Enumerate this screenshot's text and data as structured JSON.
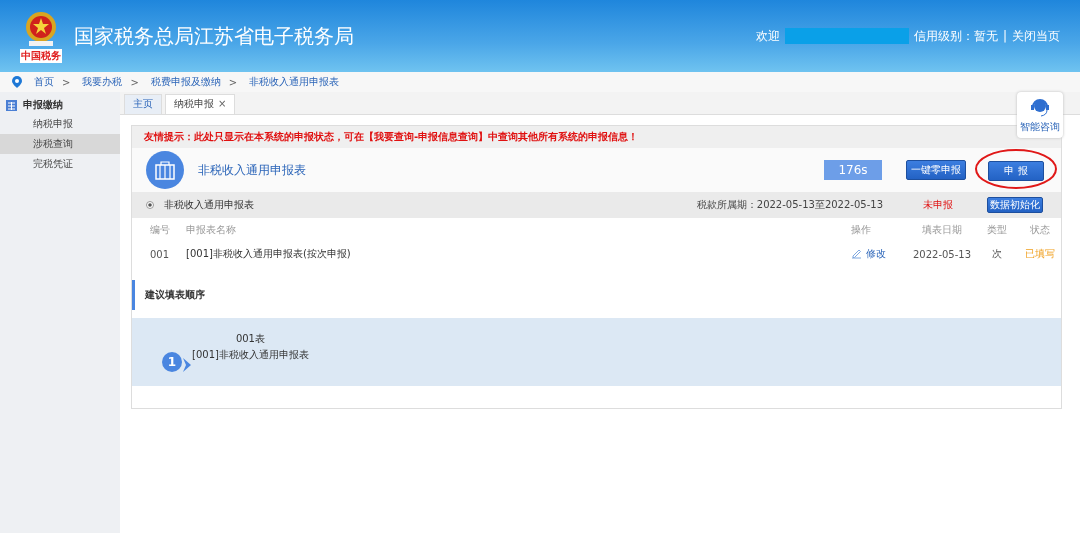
{
  "header": {
    "title": "国家税务总局江苏省电子税务局",
    "logo_caption": "中国税务",
    "welcome": "欢迎",
    "credit": "信用级别：暂无",
    "separator": "|",
    "close_page": "关闭当页"
  },
  "breadcrumb": [
    "首页",
    "我要办税",
    "税费申报及缴纳",
    "非税收入通用申报表"
  ],
  "breadcrumb_separator": ">",
  "sidebar": {
    "section": "申报缴纳",
    "items": [
      {
        "label": "纳税申报",
        "selected": false
      },
      {
        "label": "涉税查询",
        "selected": true
      },
      {
        "label": "完税凭证",
        "selected": false
      }
    ]
  },
  "tabs": [
    {
      "label": "主页",
      "selected": false,
      "closable": false
    },
    {
      "label": "纳税申报",
      "selected": true,
      "closable": true
    }
  ],
  "tab_close": "×",
  "notice": "友情提示：此处只显示在本系统的申报状态，可在【我要查询-申报信息查询】中查询其他所有系统的申报信息！",
  "form_title": "非税收入通用申报表",
  "timer": "176s",
  "buttons": {
    "zero_declare": "一键零申报",
    "declare": "申 报",
    "init": "数据初始化"
  },
  "group": {
    "name": "非税收入通用申报表",
    "period": "税款所属期：2022-05-13至2022-05-13",
    "status": "未申报"
  },
  "table": {
    "columns": [
      "编号",
      "申报表名称",
      "操作",
      "填表日期",
      "类型",
      "状态"
    ],
    "rows": [
      {
        "no": "001",
        "name": "[001]非税收入通用申报表(按次申报)",
        "action": "修改",
        "date": "2022-05-13",
        "type": "次",
        "status": "已填写"
      }
    ]
  },
  "order": {
    "title": "建议填表顺序",
    "steps": [
      {
        "number": "1",
        "code": "001表",
        "name": "[001]非税收入通用申报表"
      }
    ]
  },
  "assistant": "智能咨询"
}
